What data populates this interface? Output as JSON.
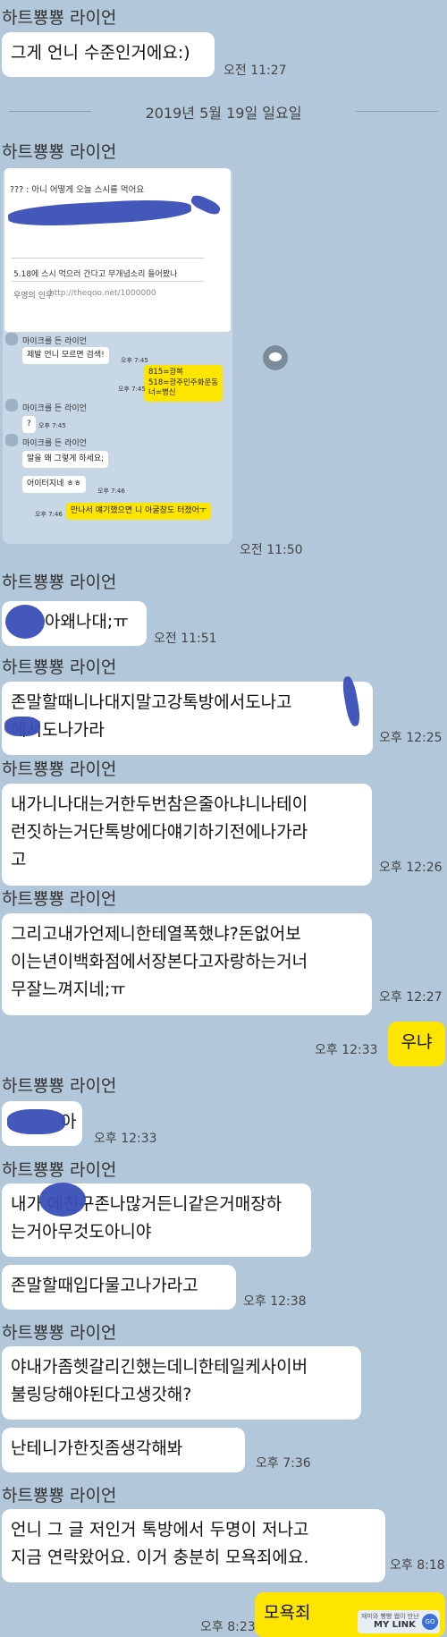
{
  "sender": "하트뿅뿅 라이언",
  "date_separator": "2019년 5월 19일 일요일",
  "messages": [
    {
      "text": "그게 언니 수준인거에요:)",
      "time": "오전 11:27"
    },
    {
      "time": "오전 11:50"
    },
    {
      "text": "아왜나대;ㅠ",
      "time": "오전 11:51"
    },
    {
      "text": "존말할때니나대지말고강톡방에서도나고\n해서도나가라",
      "time": "오후 12:25"
    },
    {
      "text": "내가니나대는거한두번참은줄아냐니나테이\n런짓하는거단톡방에다얘기하기전에나가라\n고",
      "time": "오후 12:26"
    },
    {
      "text": "그리고내가언제니한테열폭했냐?돈없어보\n이는년이백화점에서장본다고자랑하는거너\n무잘느껴지네;ㅠ",
      "time": "오후 12:27"
    },
    {
      "text": "우냐",
      "time": "오후 12:33"
    },
    {
      "text": "아",
      "time": "오후 12:33"
    },
    {
      "text": "내가 에친구존나많거든니같은거매장하\n는거아무것도아니야"
    },
    {
      "text": "존말할때입다물고나가라고",
      "time": "오후 12:38"
    },
    {
      "text": "야내가좀헷갈리긴했는데니한테일케사이버\n불링당해야된다고생갓해?"
    },
    {
      "text": "난테니가한짓좀생각해봐",
      "time": "오후 7:36"
    },
    {
      "text": "언니 그 글 저인거 톡방에서 두명이 저나고\n지금 연락왔어요. 이거 충분히 모욕죄에요.",
      "time": "오후 8:18"
    },
    {
      "text": "모욕죄",
      "time": "오후 8:23"
    }
  ],
  "embedded": {
    "post_text": "??? : 아니 어떻게 오늘 스시를 먹어요",
    "link_title": "5.18에 스시 먹으러 간다고 무개념소리 들어봤나",
    "link_sub": "우영의 인우",
    "link_url": "http://theqoo.net/1000000",
    "sender": "마이크를 든 라이언",
    "msg1": "제발 언니 모르면 검색!",
    "time1": "오후 7:45",
    "msg2": "815=광복\n518=광주민주화운동\n너=병신",
    "time2": "오후 7:45",
    "msg3": "?",
    "time3": "오후 7:45",
    "msg4": "말을 왜 그렇게 하세요;",
    "msg5": "어이터지네 ㅎㅎ",
    "time5": "오후 7:46",
    "msg6": "만나서 얘기했으면 니 아굴창도 터졌어ㅜ",
    "time6": "오후 7:46"
  },
  "watermark": {
    "line1": "재미와 빵빵 웹이 만난",
    "brand": "MY LINK",
    "go": "GO"
  },
  "colors": {
    "background": "#b2c7d9",
    "bubble": "#ffffff",
    "mine": "#fee500",
    "scribble": "#3a4fb8"
  }
}
